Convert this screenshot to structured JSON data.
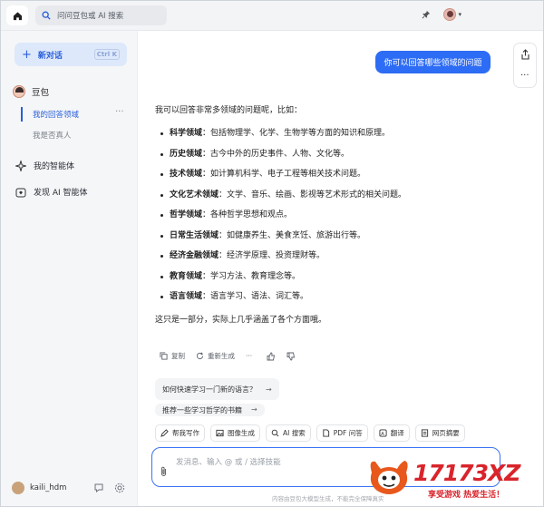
{
  "topbar": {
    "search_placeholder": "问问豆包或 AI 搜索"
  },
  "sidebar": {
    "new_chat_label": "新对话",
    "new_chat_shortcut": "Ctrl K",
    "bot_name": "豆包",
    "conversations": [
      {
        "title": "我的回答领域",
        "active": true
      },
      {
        "title": "我是否真人",
        "active": false
      }
    ],
    "links": [
      {
        "label": "我的智能体",
        "icon": "sparkle-icon"
      },
      {
        "label": "发现 AI 智能体",
        "icon": "discover-icon"
      }
    ],
    "user_name": "kaili_hdm"
  },
  "chat": {
    "user_message": "你可以回答哪些领域的问题",
    "answer_intro": "我可以回答非常多领域的问题呢，比如：",
    "answer_items": [
      {
        "title": "科学领域",
        "text": "：包括物理学、化学、生物学等方面的知识和原理。"
      },
      {
        "title": "历史领域",
        "text": "：古今中外的历史事件、人物、文化等。"
      },
      {
        "title": "技术领域",
        "text": "：如计算机科学、电子工程等相关技术问题。"
      },
      {
        "title": "文化艺术领域",
        "text": "：文学、音乐、绘画、影视等艺术形式的相关问题。"
      },
      {
        "title": "哲学领域",
        "text": "：各种哲学思想和观点。"
      },
      {
        "title": "日常生活领域",
        "text": "：如健康养生、美食烹饪、旅游出行等。"
      },
      {
        "title": "经济金融领域",
        "text": "：经济学原理、投资理财等。"
      },
      {
        "title": "教育领域",
        "text": "：学习方法、教育理念等。"
      },
      {
        "title": "语言领域",
        "text": "：语言学习、语法、词汇等。"
      }
    ],
    "answer_outro": "这只是一部分，实际上几乎涵盖了各个方面哦。",
    "actions": {
      "copy": "复制",
      "regenerate": "重新生成",
      "more": "···"
    },
    "suggestions": [
      "如何快速学习一门新的语言？",
      "推荐一些学习哲学的书籍"
    ]
  },
  "tools": [
    {
      "label": "帮我写作",
      "icon": "pen-icon"
    },
    {
      "label": "图像生成",
      "icon": "image-icon"
    },
    {
      "label": "AI 搜索",
      "icon": "search-icon"
    },
    {
      "label": "PDF 问答",
      "icon": "pdf-icon"
    },
    {
      "label": "翻译",
      "icon": "translate-icon"
    },
    {
      "label": "网页摘要",
      "icon": "webpage-icon"
    }
  ],
  "input": {
    "placeholder": "发消息、输入 @ 或 / 选择技能"
  },
  "disclaimer": "内容由豆包大模型生成，不能完全保障真实",
  "logo": {
    "number": "17173",
    "suffix": "XZ",
    "slogan": "享受游戏 热爱生活！"
  },
  "colors": {
    "accent": "#2d6cf5",
    "sidebar_bg": "#f5f6f8",
    "logo_red": "#d9242b"
  }
}
